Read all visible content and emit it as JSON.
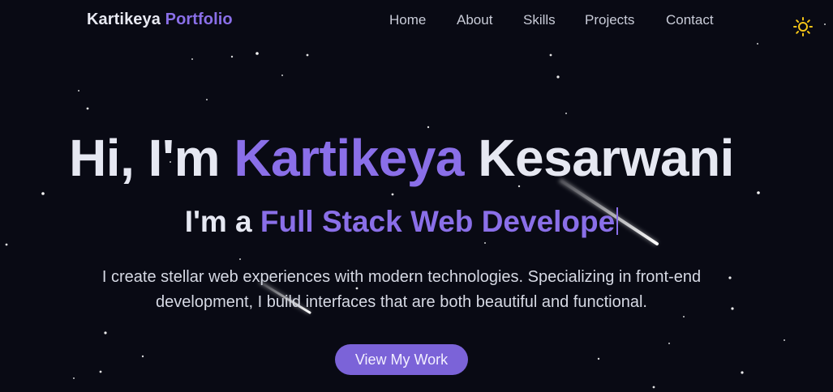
{
  "nav": {
    "brand_first": "Kartikeya",
    "brand_second": "Portfolio",
    "links": [
      "Home",
      "About",
      "Skills",
      "Projects",
      "Contact"
    ],
    "theme_icon": "sun-icon"
  },
  "hero": {
    "greeting": "Hi, I'm",
    "first_name": "Kartikeya",
    "last_name": "Kesarwani",
    "subtitle_prefix": "I'm a",
    "subtitle_role": "Full Stack Web Develope",
    "description": "I create stellar web experiences with modern technologies. Specializing in front-end development, I build interfaces that are both beautiful and functional.",
    "cta_label": "View My Work"
  },
  "colors": {
    "background": "#090a14",
    "accent": "#8a6fe8",
    "button": "#7b63d8",
    "text": "#e6e8f2",
    "sun": "#f5c518"
  }
}
